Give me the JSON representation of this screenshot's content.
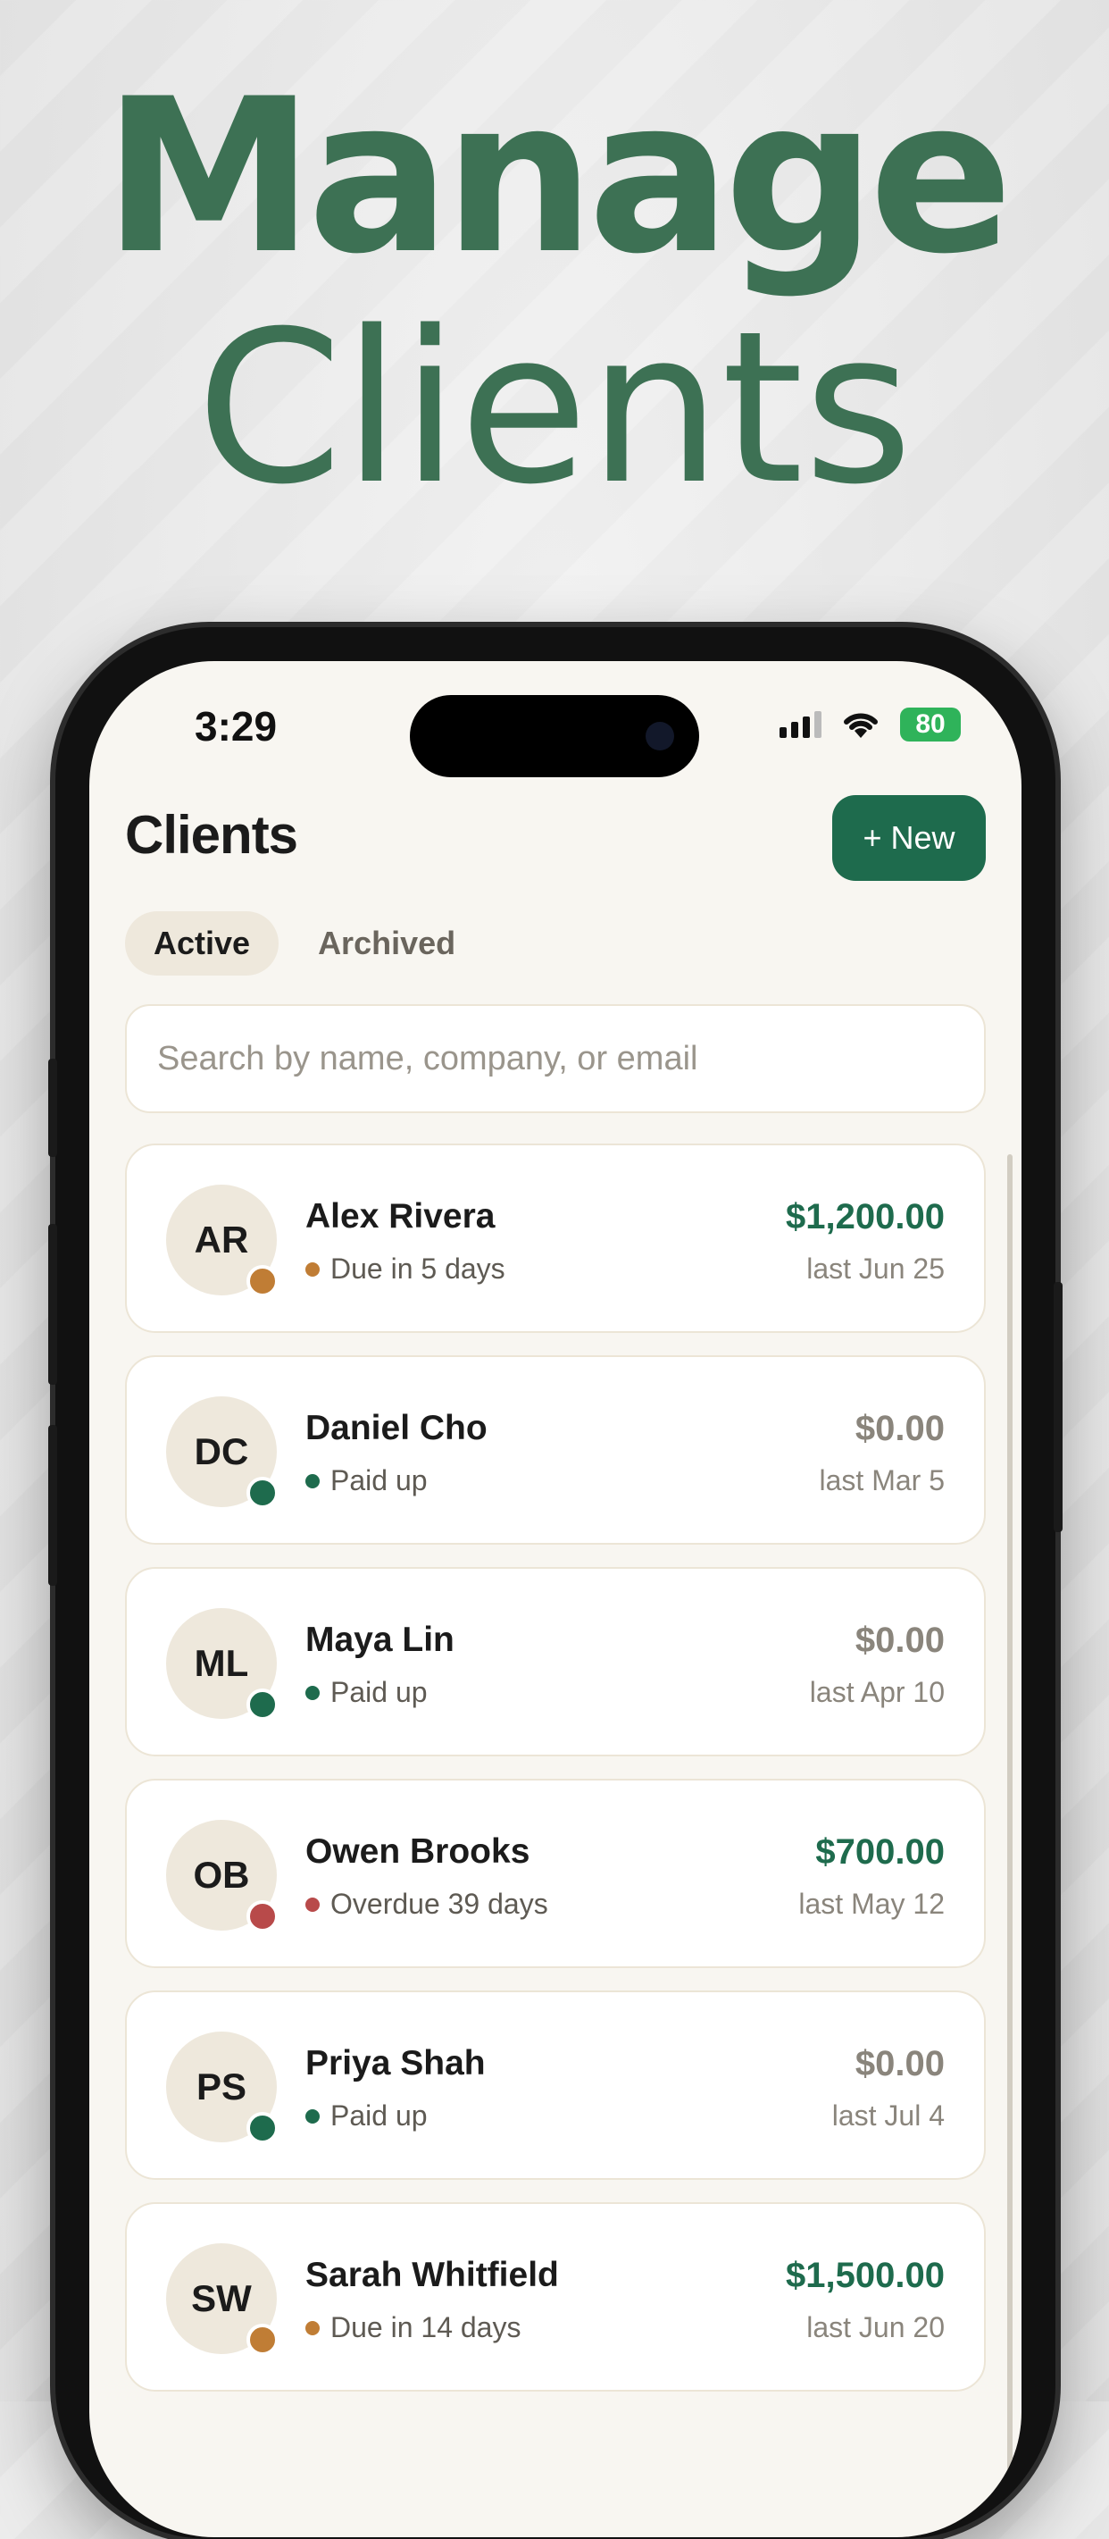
{
  "headline": {
    "line1": "Manage",
    "line2": "Clients"
  },
  "status_bar": {
    "time": "3:29",
    "battery": "80"
  },
  "header": {
    "title": "Clients",
    "new_button": "+ New"
  },
  "tabs": [
    {
      "label": "Active",
      "selected": true
    },
    {
      "label": "Archived",
      "selected": false
    }
  ],
  "search": {
    "placeholder": "Search by name, company, or email"
  },
  "colors": {
    "accent": "#1e6b4d",
    "headline": "#3d7154",
    "due": "#c07d35",
    "paid": "#1e6b4d",
    "overdue": "#b84a4a",
    "zero_amount": "#8a857c"
  },
  "clients": [
    {
      "initials": "AR",
      "name": "Alex Rivera",
      "status": "Due in 5 days",
      "status_type": "due",
      "amount": "$1,200.00",
      "last": "last Jun 25"
    },
    {
      "initials": "DC",
      "name": "Daniel Cho",
      "status": "Paid up",
      "status_type": "paid",
      "amount": "$0.00",
      "last": "last Mar 5"
    },
    {
      "initials": "ML",
      "name": "Maya Lin",
      "status": "Paid up",
      "status_type": "paid",
      "amount": "$0.00",
      "last": "last Apr 10"
    },
    {
      "initials": "OB",
      "name": "Owen Brooks",
      "status": "Overdue 39 days",
      "status_type": "overdue",
      "amount": "$700.00",
      "last": "last May 12"
    },
    {
      "initials": "PS",
      "name": "Priya Shah",
      "status": "Paid up",
      "status_type": "paid",
      "amount": "$0.00",
      "last": "last Jul 4"
    },
    {
      "initials": "SW",
      "name": "Sarah Whitfield",
      "status": "Due in 14 days",
      "status_type": "due",
      "amount": "$1,500.00",
      "last": "last Jun 20"
    }
  ]
}
